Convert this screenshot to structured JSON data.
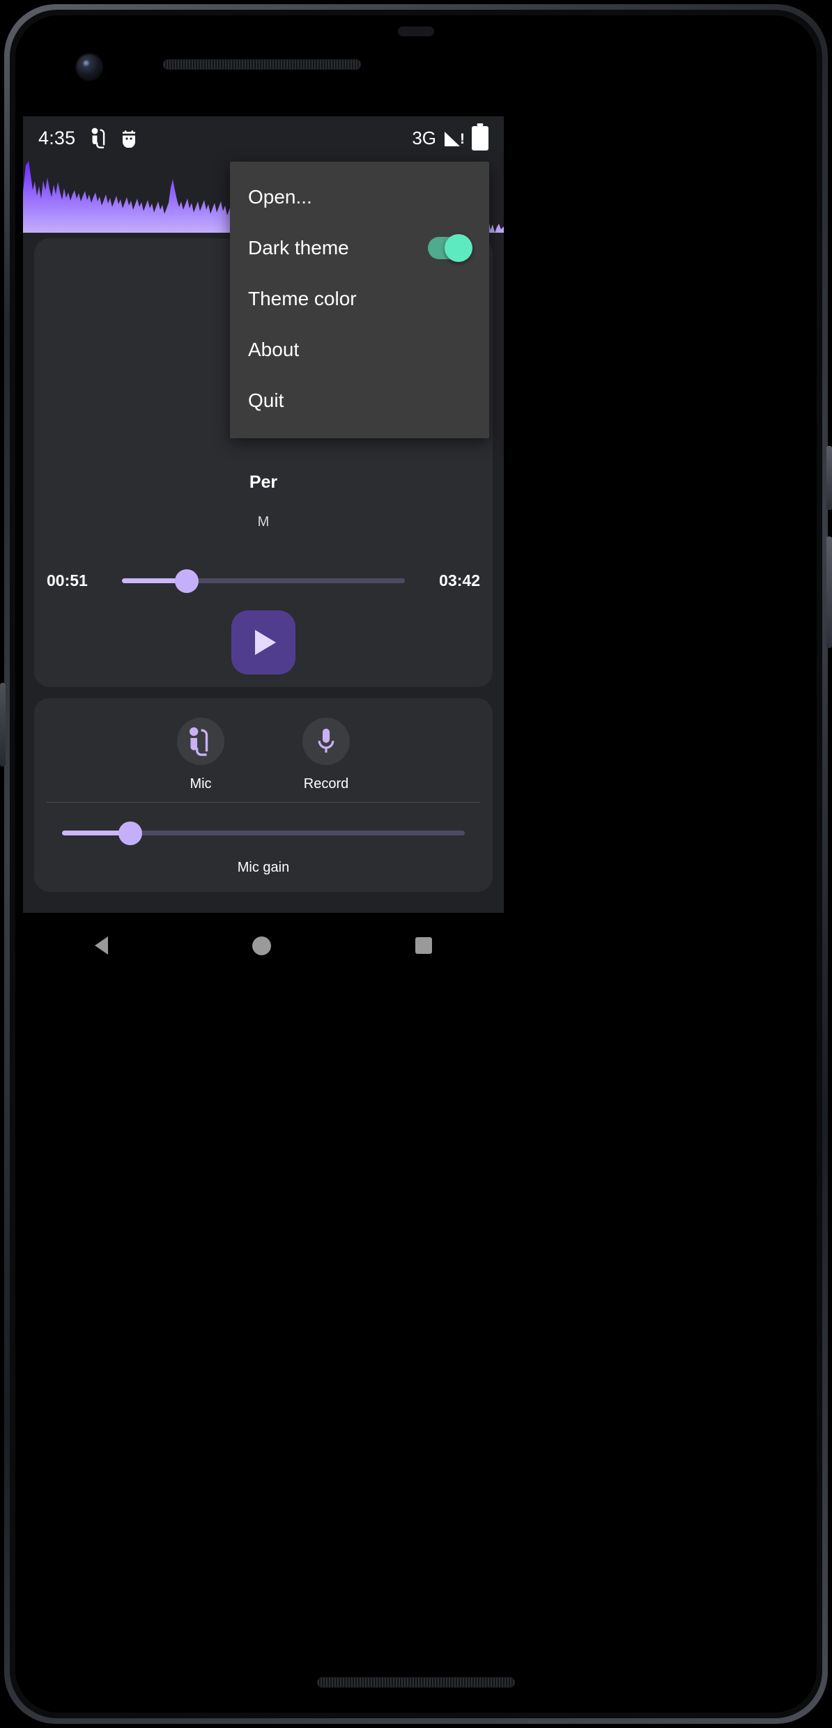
{
  "status_bar": {
    "time": "4:35",
    "left_icons": [
      "mic-cable-icon",
      "android-debug-icon"
    ],
    "network": "3G",
    "signal_icon": "signal-warning-icon",
    "signal_warning": "!",
    "battery_icon": "battery-full-icon"
  },
  "visualizer": {
    "name": "audio-waveform",
    "gradient_top": "#6a2bff",
    "gradient_bottom": "#bda6fb",
    "background": "#212226"
  },
  "player": {
    "track_title": "Per",
    "track_subtitle": "M",
    "position": "00:51",
    "duration": "03:42",
    "progress_percent": 23,
    "play_button_label": "play-button",
    "accent_color": "#503d8e",
    "slider_fill": "#cbb8fb"
  },
  "mic_panel": {
    "buttons": [
      {
        "label": "Mic",
        "icon": "mic-cable-icon"
      },
      {
        "label": "Record",
        "icon": "microphone-icon"
      }
    ],
    "gain": {
      "label": "Mic gain",
      "percent": 17
    }
  },
  "menu": {
    "items": [
      {
        "label": "Open...",
        "type": "action"
      },
      {
        "label": "Dark theme",
        "type": "toggle",
        "value": "on",
        "toggle_color": "#5eeac0"
      },
      {
        "label": "Theme color",
        "type": "action"
      },
      {
        "label": "About",
        "type": "action"
      },
      {
        "label": "Quit",
        "type": "action"
      }
    ]
  },
  "navigation_bar": {
    "back": "back-icon",
    "home": "home-icon",
    "recents": "recents-icon"
  }
}
